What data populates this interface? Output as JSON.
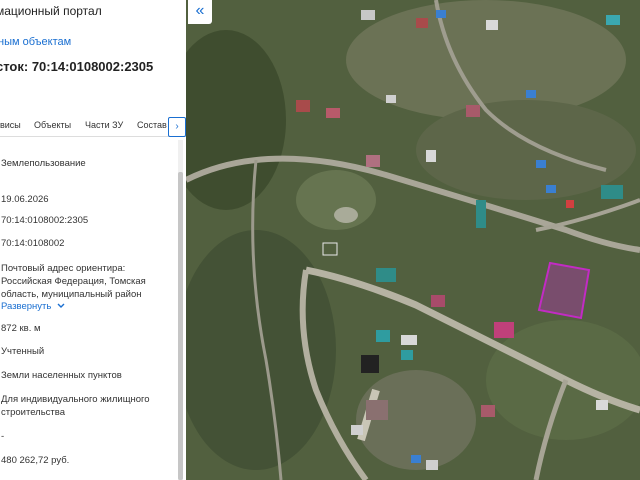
{
  "panel": {
    "portal_title": "мационный портал",
    "breadcrumb_link": "ным объектам",
    "cadastral_title": "сток: 70:14:0108002:2305",
    "tabs": [
      "висы",
      "Объекты",
      "Части ЗУ",
      "Состав"
    ],
    "fields": {
      "land_use": "Землепользование",
      "date": "19.06.2026",
      "cadastral_number": "70:14:0108002:2305",
      "quarter": "70:14:0108002",
      "address": "Почтовый адрес ориентира: Российская Федерация, Томская область, муниципальный район",
      "expand_label": "Развернуть",
      "area": "872 кв. м",
      "status": "Учтенный",
      "category": "Земли населенных пунктов",
      "permitted_use": "Для индивидуального жилищного строительства",
      "dash": "-",
      "cadastral_value": "480 262,72 руб."
    }
  },
  "icons": {
    "collapse": "double-chevron-left-icon",
    "tab_next": "chevron-right-icon",
    "expand": "chevron-down-icon"
  },
  "colors": {
    "accent": "#1a6fd1",
    "parcel_highlight": "#c22bc4"
  }
}
